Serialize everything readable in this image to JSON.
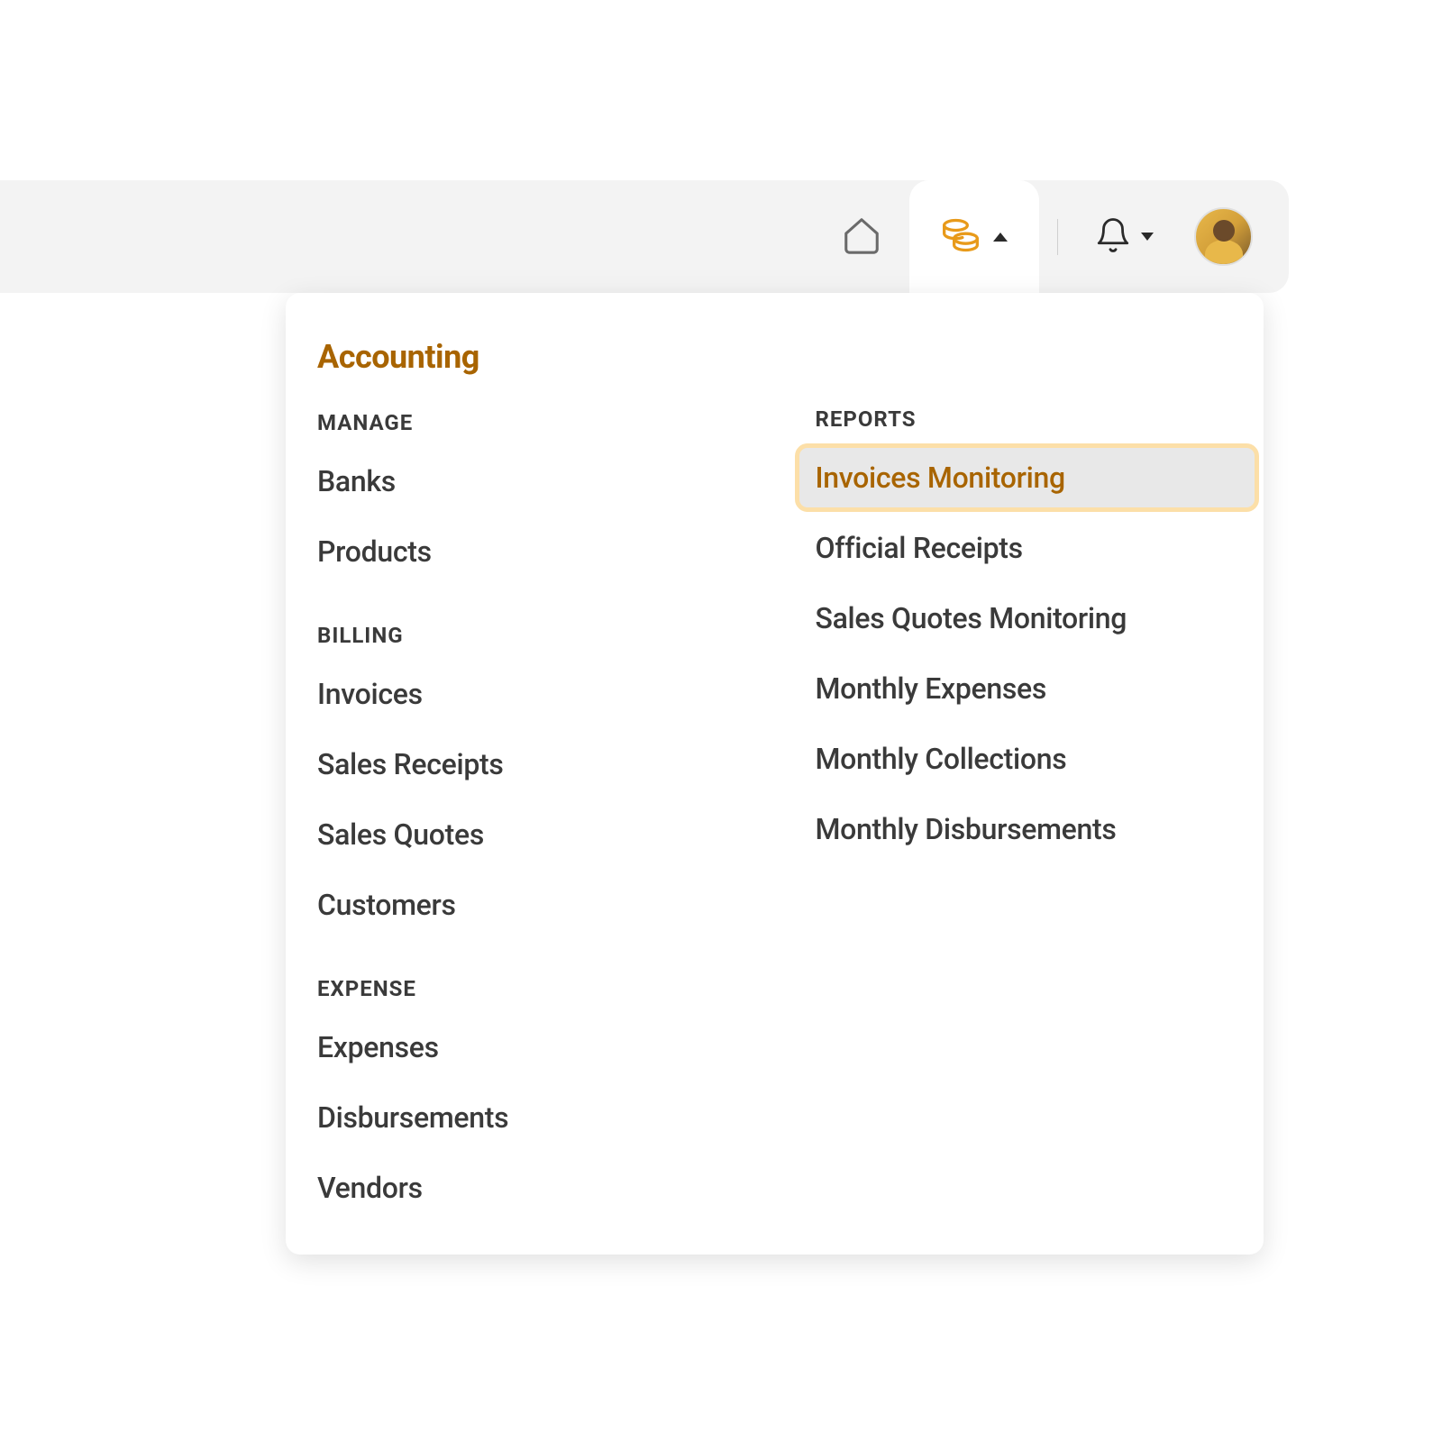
{
  "topbar": {
    "home": "home",
    "accounting_active": true,
    "bell": "notifications"
  },
  "dropdown": {
    "title": "Accounting",
    "left": {
      "sections": [
        {
          "heading": "MANAGE",
          "items": [
            "Banks",
            "Products"
          ]
        },
        {
          "heading": "BILLING",
          "items": [
            "Invoices",
            "Sales Receipts",
            "Sales Quotes",
            "Customers"
          ]
        },
        {
          "heading": "EXPENSE",
          "items": [
            "Expenses",
            "Disbursements",
            "Vendors"
          ]
        }
      ]
    },
    "right": {
      "heading": "REPORTS",
      "items": [
        "Invoices Monitoring",
        "Official Receipts",
        "Sales Quotes Monitoring",
        "Monthly Expenses",
        "Monthly Collections",
        "Monthly Disbursements"
      ],
      "active_index": 0
    }
  }
}
